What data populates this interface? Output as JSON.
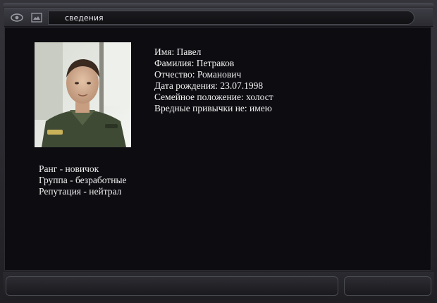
{
  "window": {
    "title": "сведения",
    "icons": [
      "eye-icon",
      "screenshot-icon"
    ]
  },
  "profile": {
    "photo_alt": "",
    "name_line": "Имя: Павел",
    "surname_line": "Фамилия: Петраков",
    "patronymic_line": "Отчество: Романович",
    "birthdate_line": "Дата рождения: 23.07.1998",
    "marital_line": "Семейное положение: холост",
    "habits_line": "Вредные привычки не: имею"
  },
  "status": {
    "rank_line": "Ранг - новичок",
    "group_line": "Группа - безработные",
    "reputation_line": "Репутация - нейтрал"
  },
  "colors": {
    "background": "#0d0c11",
    "text": "#f2f2f2",
    "frame": "#34343a"
  }
}
